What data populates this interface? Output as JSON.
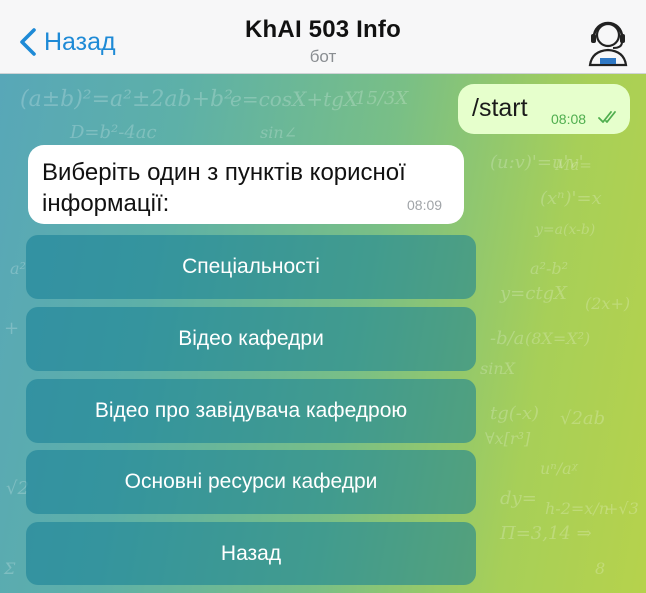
{
  "header": {
    "back_label": "Назад",
    "title": "KhAI 503 Info",
    "subtitle": "бот",
    "accent_color": "#1e8ad6"
  },
  "messages": [
    {
      "direction": "outgoing",
      "text": "/start",
      "time": "08:08",
      "status": "read"
    },
    {
      "direction": "incoming",
      "text": "Виберіть один з пунктів корисної\nінформації:",
      "time": "08:09"
    }
  ],
  "keyboard": {
    "buttons": [
      {
        "label": "Спеціальності"
      },
      {
        "label": "Відео кафедри"
      },
      {
        "label": "Відео про завідувача кафедрою"
      },
      {
        "label": "Основні ресурси кафедри"
      },
      {
        "label": "Назад"
      }
    ]
  }
}
